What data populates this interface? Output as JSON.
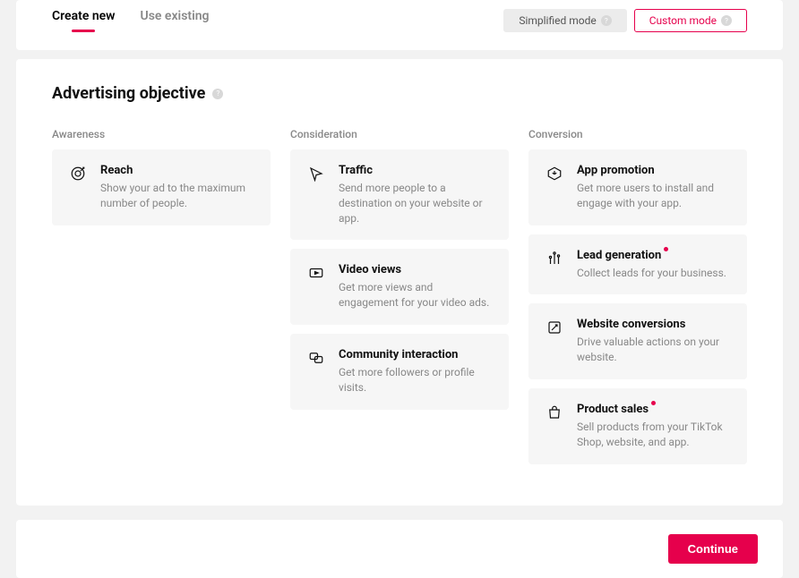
{
  "tabs": {
    "create": "Create new",
    "existing": "Use existing"
  },
  "modes": {
    "simple": "Simplified mode",
    "custom": "Custom mode"
  },
  "section_title": "Advertising objective",
  "columns": {
    "awareness": {
      "label": "Awareness",
      "cards": [
        {
          "title": "Reach",
          "desc": "Show your ad to the maximum number of people."
        }
      ]
    },
    "consideration": {
      "label": "Consideration",
      "cards": [
        {
          "title": "Traffic",
          "desc": "Send more people to a destination on your website or app."
        },
        {
          "title": "Video views",
          "desc": "Get more views and engagement for your video ads."
        },
        {
          "title": "Community interaction",
          "desc": "Get more followers or profile visits."
        }
      ]
    },
    "conversion": {
      "label": "Conversion",
      "cards": [
        {
          "title": "App promotion",
          "desc": "Get more users to install and engage with your app."
        },
        {
          "title": "Lead generation",
          "desc": "Collect leads for your business."
        },
        {
          "title": "Website conversions",
          "desc": "Drive valuable actions on your website."
        },
        {
          "title": "Product sales",
          "desc": "Sell products from your TikTok Shop, website, and app."
        }
      ]
    }
  },
  "continue": "Continue"
}
